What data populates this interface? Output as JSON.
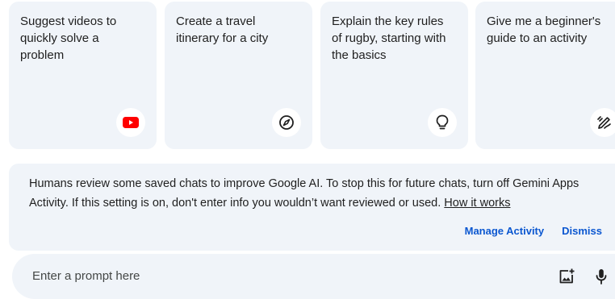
{
  "cards": [
    {
      "text": "Suggest videos to quickly solve a problem",
      "icon": "youtube-icon"
    },
    {
      "text": "Create a travel itinerary for a city",
      "icon": "compass-icon"
    },
    {
      "text": "Explain the key rules of rugby, starting with the basics",
      "icon": "lightbulb-icon"
    },
    {
      "text": "Give me a beginner's guide to an activity",
      "icon": "edit-pen-icon"
    }
  ],
  "notice": {
    "message": "Humans review some saved chats to improve Google AI. To stop this for future chats, turn off Gemini Apps Activity. If this setting is on, don't enter info you wouldn’t want reviewed or used. ",
    "link": "How it works",
    "manage_label": "Manage Activity",
    "dismiss_label": "Dismiss"
  },
  "prompt": {
    "placeholder": "Enter a prompt here",
    "image_icon": "add-image-icon",
    "mic_icon": "microphone-icon"
  },
  "colors": {
    "card_bg": "#f0f4f9",
    "link_blue": "#0b57d0",
    "youtube_red": "#ff0000",
    "text": "#1f1f1f"
  }
}
